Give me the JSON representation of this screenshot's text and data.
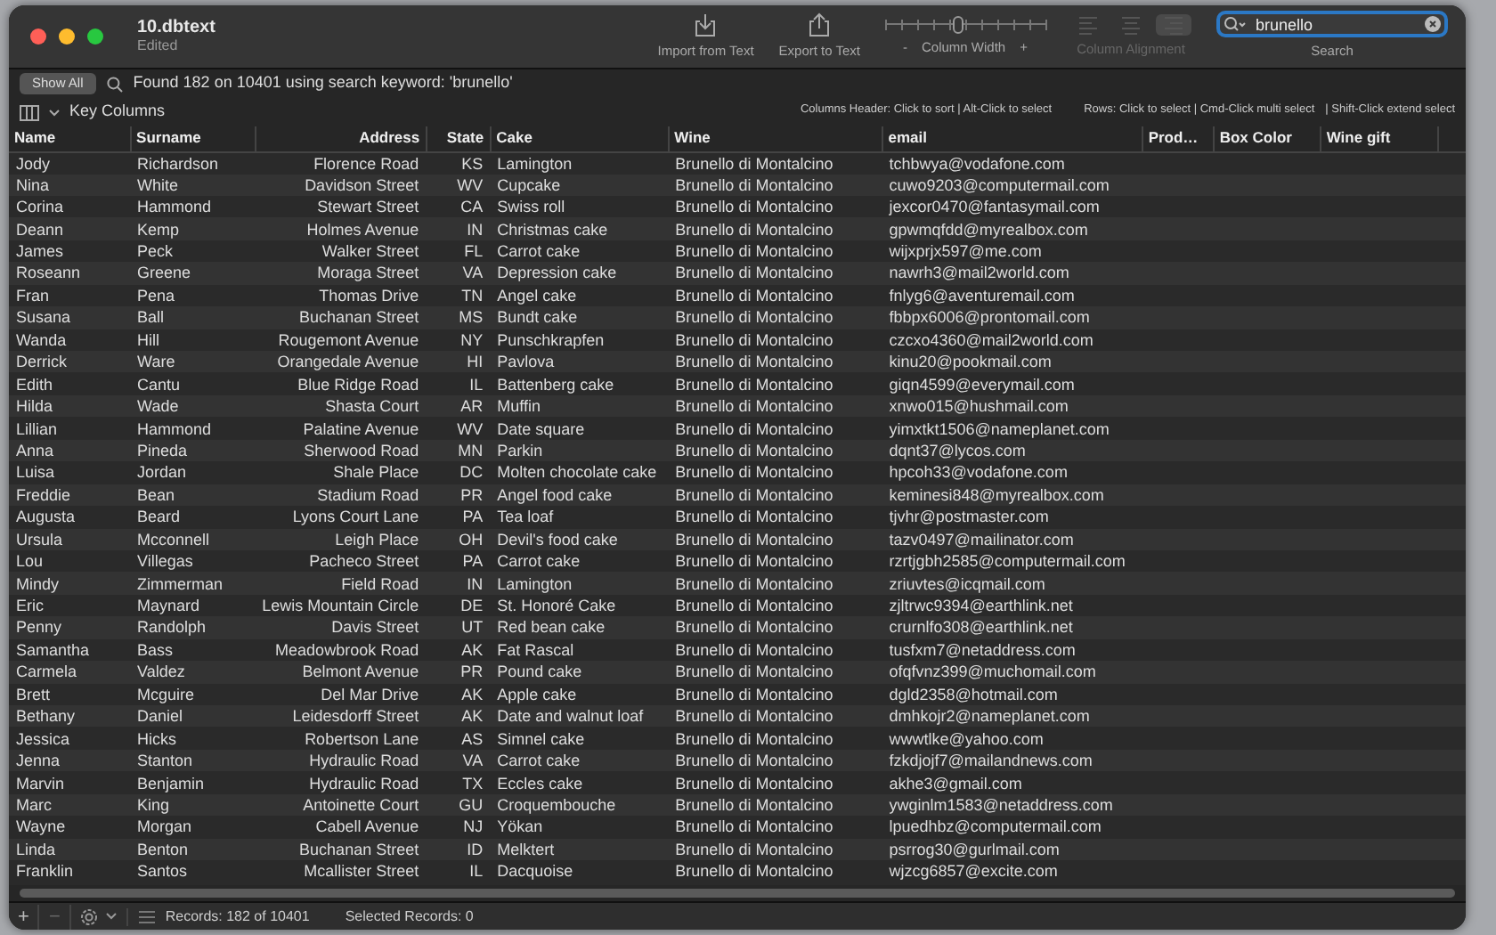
{
  "window": {
    "title": "10.dbtext",
    "subtitle": "Edited",
    "lights": [
      {
        "color": "#ff5f57"
      },
      {
        "color": "#febc2e"
      },
      {
        "color": "#28c840"
      }
    ]
  },
  "toolbar": {
    "import": "Import from Text",
    "export": "Export to Text",
    "column_width": {
      "minus": "-",
      "label": "Column Width",
      "plus": "+",
      "level": 0.45
    },
    "alignment": {
      "label": "Column Alignment",
      "disabled": true,
      "options": [
        {
          "kind": "left",
          "selected": false
        },
        {
          "kind": "center",
          "selected": false
        },
        {
          "kind": "right",
          "selected": true
        }
      ]
    },
    "search": {
      "value": "brunello",
      "label": "Search"
    }
  },
  "search_bar": {
    "show_all": "Show All",
    "found": "Found 182 on 10401 using search keyword: 'brunello'"
  },
  "key_columns": {
    "label": "Key Columns",
    "hints": [
      "Columns Header: Click to sort | Alt-Click to select",
      "Rows: Click to select | Cmd-Click multi select",
      "| Shift-Click extend select"
    ]
  },
  "table": {
    "columns": [
      {
        "label": "Name",
        "right_aligned": false
      },
      {
        "label": "Surname",
        "right_aligned": false
      },
      {
        "label": "Address",
        "right_aligned": true
      },
      {
        "label": "State",
        "right_aligned": true
      },
      {
        "label": "Cake",
        "right_aligned": false
      },
      {
        "label": "Wine",
        "right_aligned": false
      },
      {
        "label": "email",
        "right_aligned": false
      },
      {
        "label": "Prod…",
        "right_aligned": false
      },
      {
        "label": "Box Color",
        "right_aligned": false
      },
      {
        "label": "Wine gift",
        "right_aligned": false
      }
    ],
    "rows": [
      [
        "Jody",
        "Richardson",
        "Florence Road",
        "KS",
        "Lamington",
        "Brunello di Montalcino",
        "tchbwya@vodafone.com"
      ],
      [
        "Nina",
        "White",
        "Davidson Street",
        "WV",
        "Cupcake",
        "Brunello di Montalcino",
        "cuwo9203@computermail.com"
      ],
      [
        "Corina",
        "Hammond",
        "Stewart Street",
        "CA",
        "Swiss roll",
        "Brunello di Montalcino",
        "jexcor0470@fantasymail.com"
      ],
      [
        "Deann",
        "Kemp",
        "Holmes Avenue",
        "IN",
        "Christmas cake",
        "Brunello di Montalcino",
        "gpwmqfdd@myrealbox.com"
      ],
      [
        "James",
        "Peck",
        "Walker Street",
        "FL",
        "Carrot cake",
        "Brunello di Montalcino",
        "wijxprjx597@me.com"
      ],
      [
        "Roseann",
        "Greene",
        "Moraga Street",
        "VA",
        "Depression cake",
        "Brunello di Montalcino",
        "nawrh3@mail2world.com"
      ],
      [
        "Fran",
        "Pena",
        "Thomas Drive",
        "TN",
        "Angel cake",
        "Brunello di Montalcino",
        "fnlyg6@aventuremail.com"
      ],
      [
        "Susana",
        "Ball",
        "Buchanan Street",
        "MS",
        "Bundt cake",
        "Brunello di Montalcino",
        "fbbpx6006@prontomail.com"
      ],
      [
        "Wanda",
        "Hill",
        "Rougemont Avenue",
        "NY",
        "Punschkrapfen",
        "Brunello di Montalcino",
        "czcxo4360@mail2world.com"
      ],
      [
        "Derrick",
        "Ware",
        "Orangedale Avenue",
        "HI",
        "Pavlova",
        "Brunello di Montalcino",
        "kinu20@pookmail.com"
      ],
      [
        "Edith",
        "Cantu",
        "Blue Ridge Road",
        "IL",
        "Battenberg cake",
        "Brunello di Montalcino",
        "giqn4599@everymail.com"
      ],
      [
        "Hilda",
        "Wade",
        "Shasta Court",
        "AR",
        "Muffin",
        "Brunello di Montalcino",
        "xnwo015@hushmail.com"
      ],
      [
        "Lillian",
        "Hammond",
        "Palatine Avenue",
        "WV",
        "Date square",
        "Brunello di Montalcino",
        "yimxtkt1506@nameplanet.com"
      ],
      [
        "Anna",
        "Pineda",
        "Sherwood Road",
        "MN",
        "Parkin",
        "Brunello di Montalcino",
        "dqnt37@lycos.com"
      ],
      [
        "Luisa",
        "Jordan",
        "Shale Place",
        "DC",
        "Molten chocolate cake",
        "Brunello di Montalcino",
        "hpcoh33@vodafone.com"
      ],
      [
        "Freddie",
        "Bean",
        "Stadium Road",
        "PR",
        "Angel food cake",
        "Brunello di Montalcino",
        "keminesi848@myrealbox.com"
      ],
      [
        "Augusta",
        "Beard",
        "Lyons Court Lane",
        "PA",
        "Tea loaf",
        "Brunello di Montalcino",
        "tjvhr@postmaster.com"
      ],
      [
        "Ursula",
        "Mcconnell",
        "Leigh Place",
        "OH",
        "Devil's food cake",
        "Brunello di Montalcino",
        "tazv0497@mailinator.com"
      ],
      [
        "Lou",
        "Villegas",
        "Pacheco Street",
        "PA",
        "Carrot cake",
        "Brunello di Montalcino",
        "rzrtjgbh2585@computermail.com"
      ],
      [
        "Mindy",
        "Zimmerman",
        "Field Road",
        "IN",
        "Lamington",
        "Brunello di Montalcino",
        "zriuvtes@icqmail.com"
      ],
      [
        "Eric",
        "Maynard",
        "Lewis Mountain Circle",
        "DE",
        "St. Honoré Cake",
        "Brunello di Montalcino",
        "zjltrwc9394@earthlink.net"
      ],
      [
        "Penny",
        "Randolph",
        "Davis Street",
        "UT",
        "Red bean cake",
        "Brunello di Montalcino",
        "crurnlfo308@earthlink.net"
      ],
      [
        "Samantha",
        "Bass",
        "Meadowbrook Road",
        "AK",
        "Fat Rascal",
        "Brunello di Montalcino",
        "tusfxm7@netaddress.com"
      ],
      [
        "Carmela",
        "Valdez",
        "Belmont Avenue",
        "PR",
        "Pound cake",
        "Brunello di Montalcino",
        "ofqfvnz399@muchomail.com"
      ],
      [
        "Brett",
        "Mcguire",
        "Del Mar Drive",
        "AK",
        "Apple cake",
        "Brunello di Montalcino",
        "dgld2358@hotmail.com"
      ],
      [
        "Bethany",
        "Daniel",
        "Leidesdorff Street",
        "AK",
        "Date and walnut loaf",
        "Brunello di Montalcino",
        "dmhkojr2@nameplanet.com"
      ],
      [
        "Jessica",
        "Hicks",
        "Robertson Lane",
        "AS",
        "Simnel cake",
        "Brunello di Montalcino",
        "wwwtlke@yahoo.com"
      ],
      [
        "Jenna",
        "Stanton",
        "Hydraulic Road",
        "VA",
        "Carrot cake",
        "Brunello di Montalcino",
        "fzkdjojf7@mailandnews.com"
      ],
      [
        "Marvin",
        "Benjamin",
        "Hydraulic Road",
        "TX",
        "Eccles cake",
        "Brunello di Montalcino",
        "akhe3@gmail.com"
      ],
      [
        "Marc",
        "King",
        "Antoinette Court",
        "GU",
        "Croquembouche",
        "Brunello di Montalcino",
        "ywginlm1583@netaddress.com"
      ],
      [
        "Wayne",
        "Morgan",
        "Cabell Avenue",
        "NJ",
        "Yökan",
        "Brunello di Montalcino",
        "lpuedhbz@computermail.com"
      ],
      [
        "Linda",
        "Benton",
        "Buchanan Street",
        "ID",
        "Melktert",
        "Brunello di Montalcino",
        "psrrog30@gurlmail.com"
      ],
      [
        "Franklin",
        "Santos",
        "Mcallister Street",
        "IL",
        "Dacquoise",
        "Brunello di Montalcino",
        "wjzcg6857@excite.com"
      ]
    ]
  },
  "status_bar": {
    "add": "+",
    "remove": "−",
    "records": "Records: 182 of 10401",
    "selected": "Selected Records: 0"
  }
}
